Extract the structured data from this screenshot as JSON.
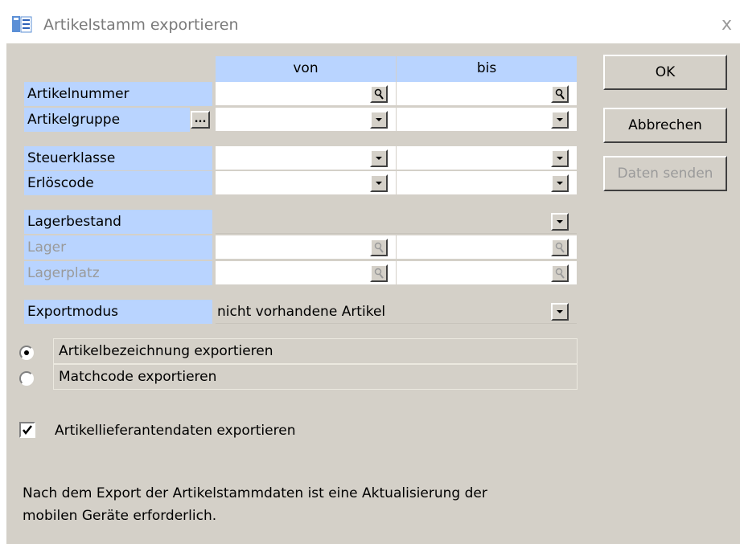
{
  "window": {
    "title": "Artikelstamm exportieren",
    "close_glyph": "x",
    "title_icon": "list-document-icon"
  },
  "columns": {
    "from": "von",
    "to": "bis"
  },
  "rows": {
    "artikelnummer": {
      "label": "Artikelnummer",
      "from_value": "",
      "to_value": ""
    },
    "artikelgruppe": {
      "label": "Artikelgruppe",
      "browse_label": "...",
      "from_value": "",
      "to_value": ""
    },
    "steuerklasse": {
      "label": "Steuerklasse",
      "from_value": "",
      "to_value": ""
    },
    "erloescode": {
      "label": "Erlöscode",
      "from_value": "",
      "to_value": ""
    },
    "lagerbestand": {
      "label": "Lagerbestand",
      "value": ""
    },
    "lager": {
      "label": "Lager",
      "from_value": "",
      "to_value": ""
    },
    "lagerplatz": {
      "label": "Lagerplatz",
      "from_value": "",
      "to_value": ""
    },
    "exportmodus": {
      "label": "Exportmodus",
      "value": "nicht vorhandene Artikel"
    }
  },
  "buttons": {
    "ok": "OK",
    "cancel": "Abbrechen",
    "send": "Daten senden"
  },
  "options": {
    "radio_bezeichnung": {
      "label": "Artikelbezeichnung exportieren",
      "selected": true
    },
    "radio_matchcode": {
      "label": "Matchcode exportieren",
      "selected": false
    },
    "lieferanten": {
      "label": "Artikellieferantendaten exportieren",
      "checked": true
    }
  },
  "note": {
    "line1": "Nach dem Export der Artikelstammdaten ist eine Aktualisierung der",
    "line2": "mobilen Geräte erforderlich."
  },
  "colors": {
    "label_bg": "#b9d4ff",
    "dialog_bg": "#d4d0c8",
    "disabled_text": "#9a9a9a"
  }
}
